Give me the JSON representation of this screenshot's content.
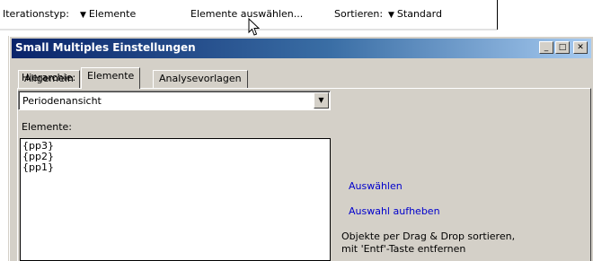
{
  "toolbar": {
    "iteration_label": "Iterationstyp:",
    "iteration_value": "Elemente",
    "select_elements": "Elemente auswählen...",
    "sort_label": "Sortieren:",
    "sort_value": "Standard"
  },
  "dialog": {
    "title": "Small Multiples Einstellungen",
    "window_buttons": {
      "minimize": "_",
      "maximize": "□",
      "close": "✕"
    },
    "tabs": [
      {
        "label": "Allgemein",
        "active": false
      },
      {
        "label": "Elemente",
        "active": true
      },
      {
        "label": "Analysevorlagen",
        "active": false
      }
    ],
    "hierarchy": {
      "label": "Hierarchie:",
      "value": "Periodenansicht"
    },
    "elements": {
      "label": "Elemente:",
      "items": [
        "{pp3}",
        "{pp2}",
        "{pp1}"
      ]
    },
    "select_link": "Auswählen",
    "deselect_link": "Auswahl aufheben",
    "hint_line1": "Objekte per Drag & Drop sortieren,",
    "hint_line2": "mit 'Entf'-Taste entfernen"
  },
  "icons": {
    "dropdown_arrow": "chevron-down-icon",
    "cursor": "mouse-pointer-icon"
  },
  "colors": {
    "dialog_face": "#d4d0c8",
    "title_gradient_start": "#0a246a",
    "title_gradient_end": "#a6caf0",
    "link": "#0000cc"
  }
}
